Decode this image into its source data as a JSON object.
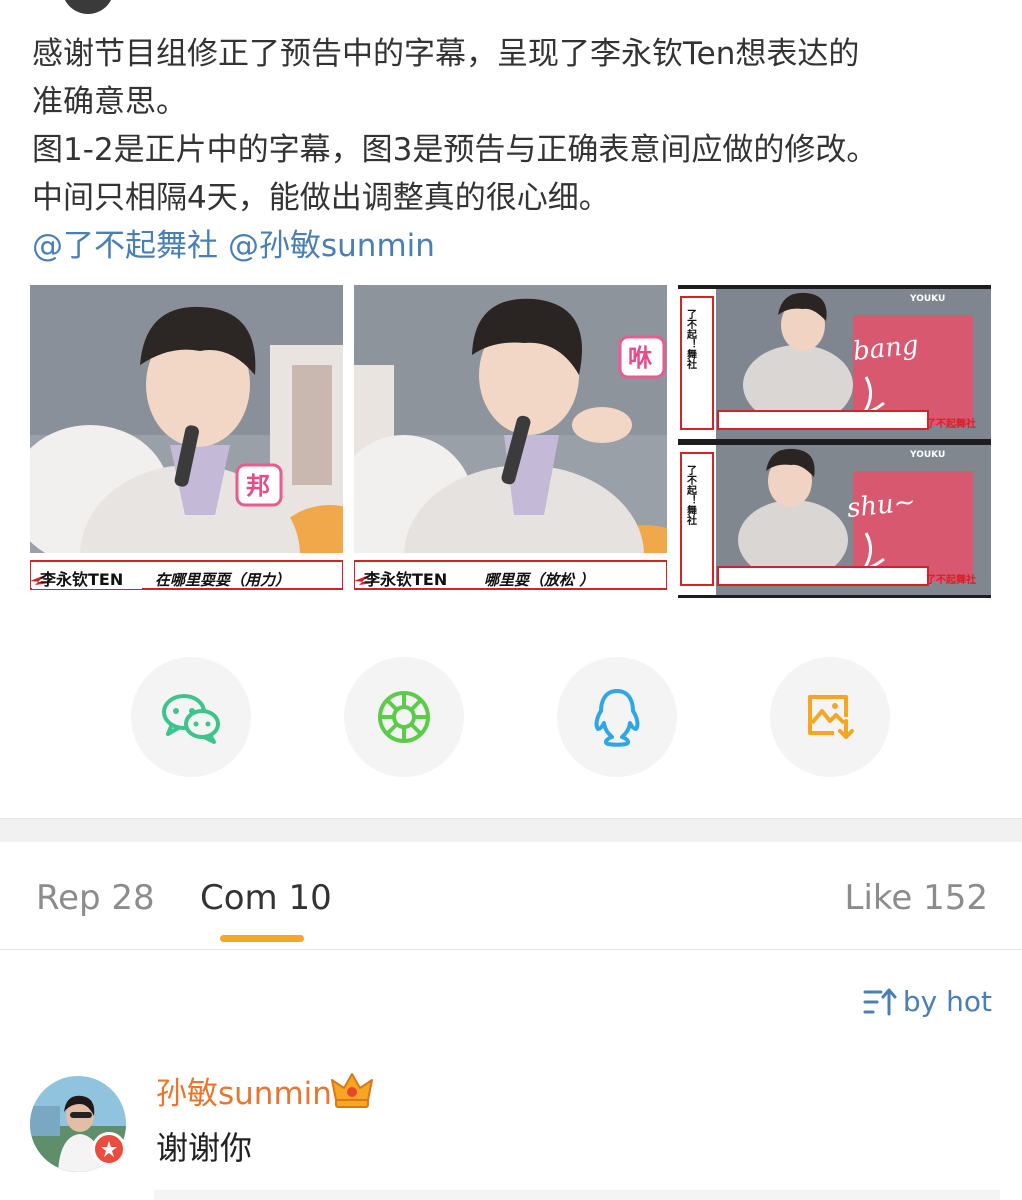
{
  "post": {
    "lines": [
      "感谢节目组修正了预告中的字幕，呈现了李永钦Ten想表达的",
      "准确意思。",
      "图1-2是正片中的字幕，图3是预告与正确表意间应做的修改。",
      "中间只相隔4天，能做出调整真的很心细。"
    ],
    "mentions": [
      "@了不起舞社",
      "@孙敏sunmin"
    ]
  },
  "photos": {
    "p1": {
      "name_tag": "李永钦TEN",
      "caption": "在哪里耍耍（用力）",
      "sticker": "邦"
    },
    "p2": {
      "name_tag": "李永钦TEN",
      "caption": "哪里耍（放松 ）",
      "sticker": "咻"
    },
    "p3": {
      "top": {
        "logo": "YOUKU",
        "title": "了不起！舞社",
        "handwriting": "bang",
        "watermark": "了不起舞社"
      },
      "bottom": {
        "logo": "YOUKU",
        "title": "了不起！舞社",
        "handwriting": "shu~",
        "watermark": "了不起舞社"
      }
    }
  },
  "share": [
    {
      "icon": "wechat-icon",
      "color": "#3cc48c"
    },
    {
      "icon": "moments-icon",
      "color": "#5ccb4a"
    },
    {
      "icon": "qq-icon",
      "color": "#2fa6e8"
    },
    {
      "icon": "save-image-icon",
      "color": "#f5a623"
    }
  ],
  "tabs": {
    "reposts": "Rep 28",
    "comments": "Com 10",
    "likes": "Like 152"
  },
  "sort": {
    "label": "by hot"
  },
  "comment": {
    "user": "孙敏sunmin",
    "text": "谢谢你"
  },
  "colors": {
    "accent": "#f5a623",
    "link": "#4a7fb5",
    "username": "#e8772e"
  }
}
